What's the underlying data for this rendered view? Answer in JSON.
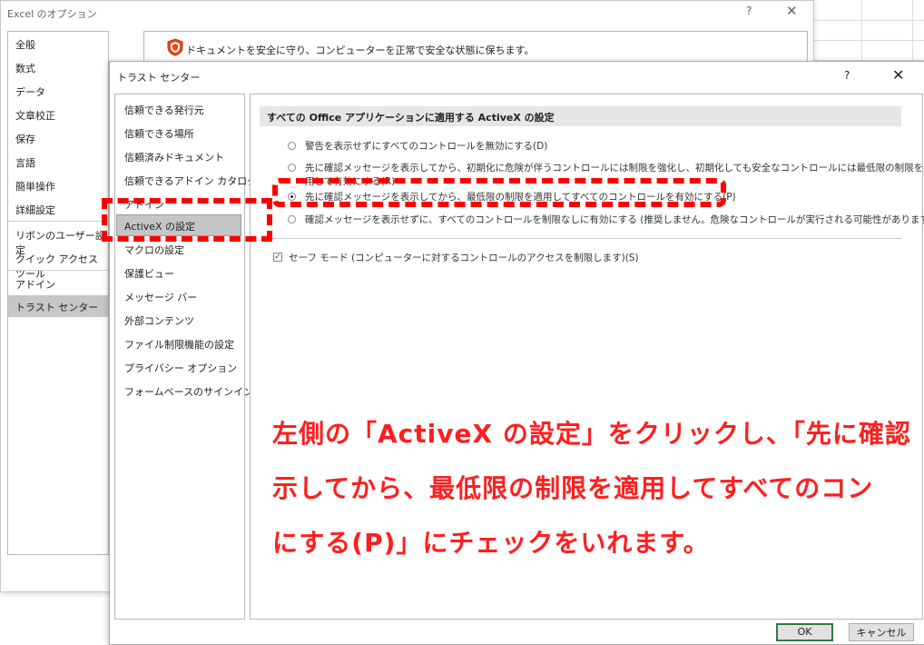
{
  "options_dialog": {
    "title": "Excel のオプション",
    "help": "?",
    "close": "✕",
    "nav": [
      "全般",
      "数式",
      "データ",
      "文章校正",
      "保存",
      "言語",
      "簡単操作",
      "詳細設定",
      "リボンのユーザー設定",
      "クイック アクセス ツール",
      "アドイン",
      "トラスト センター"
    ],
    "selected": "トラスト センター",
    "headline": "ドキュメントを安全に守り、コンピューターを正常で安全な状態に保ちます。"
  },
  "trust_center": {
    "title": "トラスト センター",
    "help": "?",
    "close": "✕",
    "nav": [
      "信頼できる発行元",
      "信頼できる場所",
      "信頼済みドキュメント",
      "信頼できるアドイン カタログ",
      "アドイン",
      "ActiveX の設定",
      "マクロの設定",
      "保護ビュー",
      "メッセージ バー",
      "外部コンテンツ",
      "ファイル制限機能の設定",
      "プライバシー オプション",
      "フォームベースのサインイン"
    ],
    "selected": "ActiveX の設定",
    "section_header": "すべての Office アプリケーションに適用する ActiveX の設定",
    "radio_options": [
      "警告を表示せずにすべてのコントロールを無効にする(D)",
      "先に確認メッセージを表示してから、初期化に危険が伴うコントロールには制限を強化し、初期化しても安全なコントロールには最低限の制限を適",
      "用して有効にする(R)",
      "先に確認メッセージを表示してから、最低限の制限を適用してすべてのコントロールを有効にする(P)",
      "確認メッセージを表示せずに、すべてのコントロールを制限なしに有効にする (推奨しません。危険なコントロールが実行される可能性があります)(E)"
    ],
    "selected_option": 2,
    "safe_mode": "セーフ モード (コンピューターに対するコントロールのアクセスを制限します)(S)",
    "safe_mode_checked": true,
    "ok_label": "OK",
    "cancel_label": "キャンセル"
  },
  "annotation": {
    "color": "#ff1e1e",
    "lines": [
      "左側の「ActiveX の設定」をクリックし、「先に確認",
      "示してから、最低限の制限を適用してすべてのコン",
      "にする(P)」にチェックをいれます。"
    ]
  }
}
